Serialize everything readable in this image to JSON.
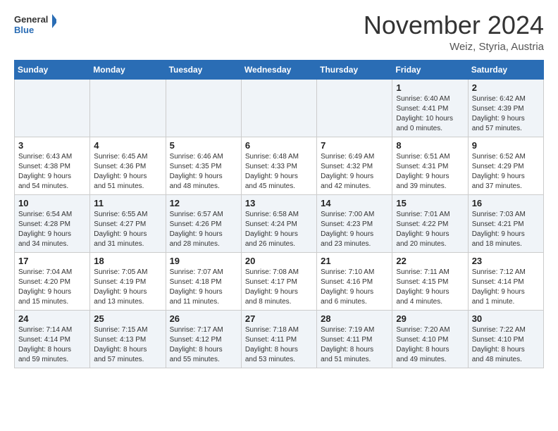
{
  "header": {
    "logo_general": "General",
    "logo_blue": "Blue",
    "month": "November 2024",
    "location": "Weiz, Styria, Austria"
  },
  "weekdays": [
    "Sunday",
    "Monday",
    "Tuesday",
    "Wednesday",
    "Thursday",
    "Friday",
    "Saturday"
  ],
  "weeks": [
    [
      {
        "day": "",
        "info": ""
      },
      {
        "day": "",
        "info": ""
      },
      {
        "day": "",
        "info": ""
      },
      {
        "day": "",
        "info": ""
      },
      {
        "day": "",
        "info": ""
      },
      {
        "day": "1",
        "info": "Sunrise: 6:40 AM\nSunset: 4:41 PM\nDaylight: 10 hours\nand 0 minutes."
      },
      {
        "day": "2",
        "info": "Sunrise: 6:42 AM\nSunset: 4:39 PM\nDaylight: 9 hours\nand 57 minutes."
      }
    ],
    [
      {
        "day": "3",
        "info": "Sunrise: 6:43 AM\nSunset: 4:38 PM\nDaylight: 9 hours\nand 54 minutes."
      },
      {
        "day": "4",
        "info": "Sunrise: 6:45 AM\nSunset: 4:36 PM\nDaylight: 9 hours\nand 51 minutes."
      },
      {
        "day": "5",
        "info": "Sunrise: 6:46 AM\nSunset: 4:35 PM\nDaylight: 9 hours\nand 48 minutes."
      },
      {
        "day": "6",
        "info": "Sunrise: 6:48 AM\nSunset: 4:33 PM\nDaylight: 9 hours\nand 45 minutes."
      },
      {
        "day": "7",
        "info": "Sunrise: 6:49 AM\nSunset: 4:32 PM\nDaylight: 9 hours\nand 42 minutes."
      },
      {
        "day": "8",
        "info": "Sunrise: 6:51 AM\nSunset: 4:31 PM\nDaylight: 9 hours\nand 39 minutes."
      },
      {
        "day": "9",
        "info": "Sunrise: 6:52 AM\nSunset: 4:29 PM\nDaylight: 9 hours\nand 37 minutes."
      }
    ],
    [
      {
        "day": "10",
        "info": "Sunrise: 6:54 AM\nSunset: 4:28 PM\nDaylight: 9 hours\nand 34 minutes."
      },
      {
        "day": "11",
        "info": "Sunrise: 6:55 AM\nSunset: 4:27 PM\nDaylight: 9 hours\nand 31 minutes."
      },
      {
        "day": "12",
        "info": "Sunrise: 6:57 AM\nSunset: 4:26 PM\nDaylight: 9 hours\nand 28 minutes."
      },
      {
        "day": "13",
        "info": "Sunrise: 6:58 AM\nSunset: 4:24 PM\nDaylight: 9 hours\nand 26 minutes."
      },
      {
        "day": "14",
        "info": "Sunrise: 7:00 AM\nSunset: 4:23 PM\nDaylight: 9 hours\nand 23 minutes."
      },
      {
        "day": "15",
        "info": "Sunrise: 7:01 AM\nSunset: 4:22 PM\nDaylight: 9 hours\nand 20 minutes."
      },
      {
        "day": "16",
        "info": "Sunrise: 7:03 AM\nSunset: 4:21 PM\nDaylight: 9 hours\nand 18 minutes."
      }
    ],
    [
      {
        "day": "17",
        "info": "Sunrise: 7:04 AM\nSunset: 4:20 PM\nDaylight: 9 hours\nand 15 minutes."
      },
      {
        "day": "18",
        "info": "Sunrise: 7:05 AM\nSunset: 4:19 PM\nDaylight: 9 hours\nand 13 minutes."
      },
      {
        "day": "19",
        "info": "Sunrise: 7:07 AM\nSunset: 4:18 PM\nDaylight: 9 hours\nand 11 minutes."
      },
      {
        "day": "20",
        "info": "Sunrise: 7:08 AM\nSunset: 4:17 PM\nDaylight: 9 hours\nand 8 minutes."
      },
      {
        "day": "21",
        "info": "Sunrise: 7:10 AM\nSunset: 4:16 PM\nDaylight: 9 hours\nand 6 minutes."
      },
      {
        "day": "22",
        "info": "Sunrise: 7:11 AM\nSunset: 4:15 PM\nDaylight: 9 hours\nand 4 minutes."
      },
      {
        "day": "23",
        "info": "Sunrise: 7:12 AM\nSunset: 4:14 PM\nDaylight: 9 hours\nand 1 minute."
      }
    ],
    [
      {
        "day": "24",
        "info": "Sunrise: 7:14 AM\nSunset: 4:14 PM\nDaylight: 8 hours\nand 59 minutes."
      },
      {
        "day": "25",
        "info": "Sunrise: 7:15 AM\nSunset: 4:13 PM\nDaylight: 8 hours\nand 57 minutes."
      },
      {
        "day": "26",
        "info": "Sunrise: 7:17 AM\nSunset: 4:12 PM\nDaylight: 8 hours\nand 55 minutes."
      },
      {
        "day": "27",
        "info": "Sunrise: 7:18 AM\nSunset: 4:11 PM\nDaylight: 8 hours\nand 53 minutes."
      },
      {
        "day": "28",
        "info": "Sunrise: 7:19 AM\nSunset: 4:11 PM\nDaylight: 8 hours\nand 51 minutes."
      },
      {
        "day": "29",
        "info": "Sunrise: 7:20 AM\nSunset: 4:10 PM\nDaylight: 8 hours\nand 49 minutes."
      },
      {
        "day": "30",
        "info": "Sunrise: 7:22 AM\nSunset: 4:10 PM\nDaylight: 8 hours\nand 48 minutes."
      }
    ]
  ]
}
